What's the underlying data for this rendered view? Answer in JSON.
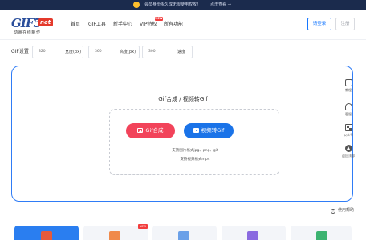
{
  "notice": {
    "text": "会员身份永久成无限使用权攻！",
    "link": "点击查看 →"
  },
  "logo": {
    "main": "GIF5",
    "net": "net",
    "subtitle": "动画在线制作"
  },
  "nav": {
    "items": [
      "首页",
      "GIF工具",
      "新手中心",
      "VIP特权",
      "所有功能"
    ],
    "new_badge": "NEW"
  },
  "account": {
    "login": "请登录",
    "register": "注册"
  },
  "settings": {
    "label": "GIF设置",
    "width_value": "320",
    "width_unit": "宽度(px)",
    "height_value": "360",
    "height_unit": "高度(px)",
    "speed_value": "300",
    "speed_unit": "速度"
  },
  "main": {
    "title": "Gif合成 / 视频转Gif",
    "btn_gif": "Gif合成",
    "btn_video": "视频转Gif",
    "support_image": "支持图片格式jpg、png、gif",
    "support_video": "支持视频格式mp4"
  },
  "sidebar": {
    "items": [
      {
        "label": "教程",
        "icon": "book-icon"
      },
      {
        "label": "客服",
        "icon": "headset-icon"
      },
      {
        "label": "公众号",
        "icon": "qrcode-icon"
      },
      {
        "label": "返回顶部",
        "icon": "back-to-top-icon"
      }
    ]
  },
  "help": {
    "label": "使用帮助"
  },
  "tools": {
    "new_badge": "NEW"
  },
  "colors": {
    "primary": "#2f7cf6",
    "red": "#f2435a",
    "blue_button": "#1a73e8",
    "notice_bg": "#1b2b4d"
  }
}
